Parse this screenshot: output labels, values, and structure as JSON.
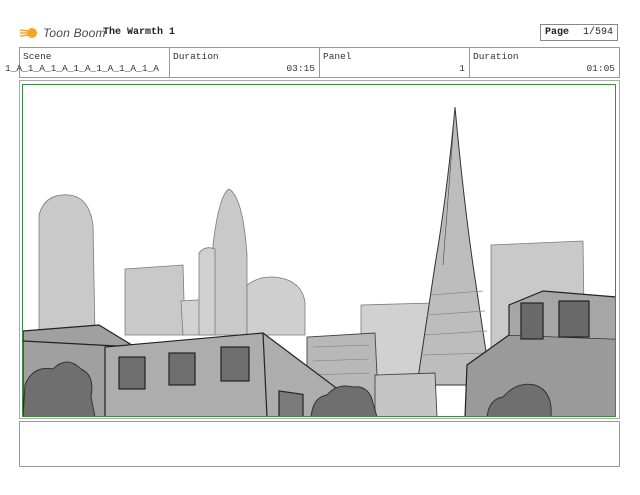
{
  "header": {
    "logo_text": "Toon Boom",
    "title": "The Warmth 1",
    "page_label": "Page",
    "page_value": "1/594"
  },
  "info": {
    "scene_label": "Scene",
    "scene_value": "1_A_1_A_1_A_1_A_1_A_1_A_1_A",
    "duration_label": "Duration",
    "duration_value": "03:15",
    "panel_label": "Panel",
    "panel_value": "1",
    "duration2_label": "Duration",
    "duration2_value": "01:05"
  },
  "colors": {
    "frame_border": "#3c8a3c",
    "logo_orange": "#f5a623"
  }
}
